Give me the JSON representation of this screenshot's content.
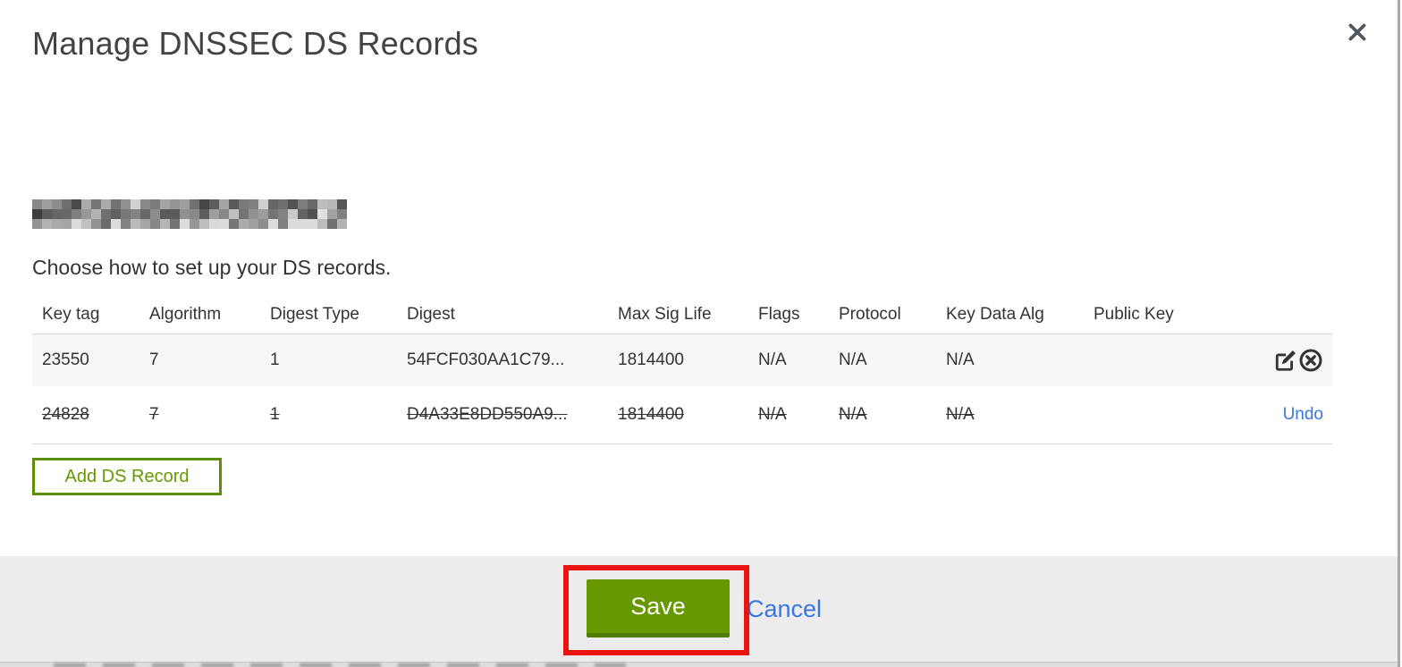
{
  "modal": {
    "title": "Manage DNSSEC DS Records",
    "instruction": "Choose how to set up your DS records.",
    "domain_redacted": true
  },
  "table": {
    "columns": [
      "Key tag",
      "Algorithm",
      "Digest Type",
      "Digest",
      "Max Sig Life",
      "Flags",
      "Protocol",
      "Key Data Alg",
      "Public Key"
    ],
    "rows": [
      {
        "key_tag": "23550",
        "algorithm": "7",
        "digest_type": "1",
        "digest": "54FCF030AA1C79...",
        "max_sig_life": "1814400",
        "flags": "N/A",
        "protocol": "N/A",
        "key_data_alg": "N/A",
        "public_key": "",
        "state": "normal"
      },
      {
        "key_tag": "24828",
        "algorithm": "7",
        "digest_type": "1",
        "digest": "D4A33E8DD550A9...",
        "max_sig_life": "1814400",
        "flags": "N/A",
        "protocol": "N/A",
        "key_data_alg": "N/A",
        "public_key": "",
        "state": "deleted",
        "undo_label": "Undo"
      }
    ]
  },
  "buttons": {
    "add_ds_record": "Add DS Record",
    "save": "Save",
    "cancel": "Cancel"
  },
  "colors": {
    "green": "#669900",
    "green_dark": "#4e7c04",
    "link_blue": "#3b76e0",
    "annotation_red": "#e9130f",
    "footer_gray": "#ececec"
  }
}
